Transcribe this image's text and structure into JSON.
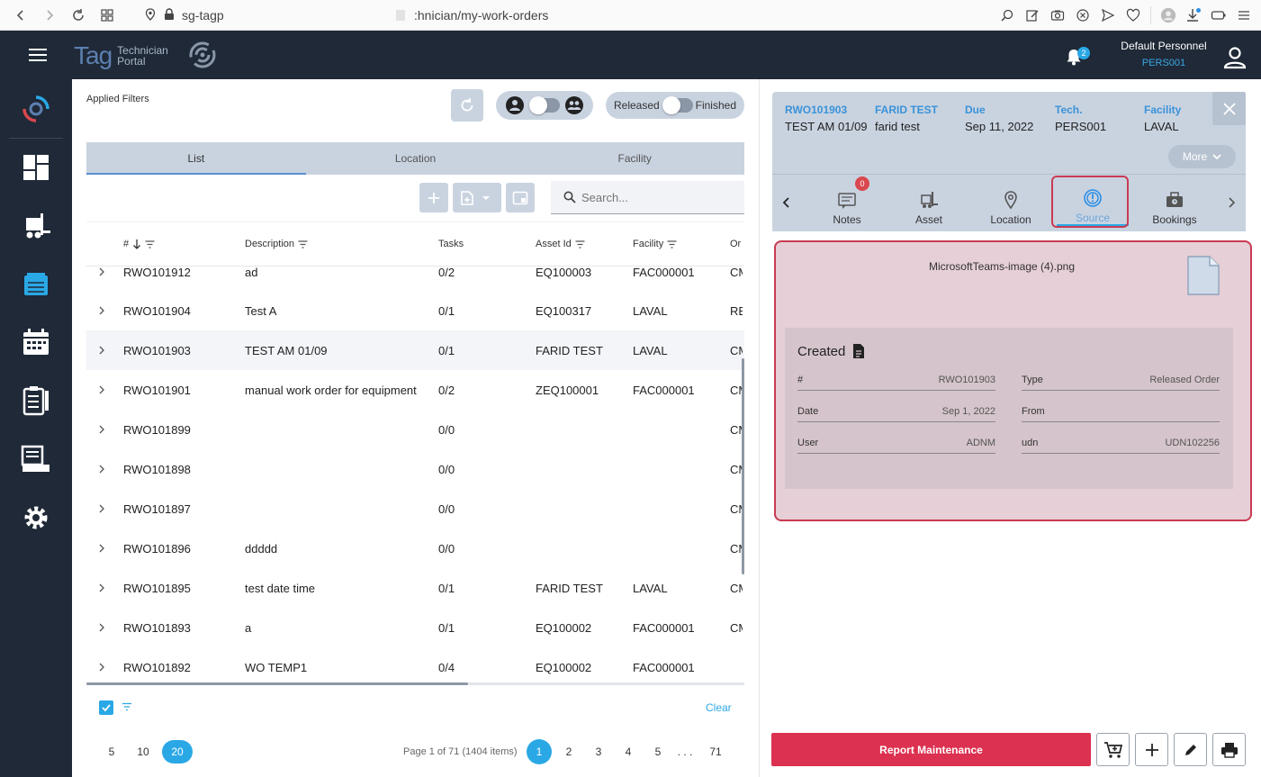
{
  "browser": {
    "url_host": "sg-tagp",
    "url_path": ":hnician/my-work-orders"
  },
  "header": {
    "brand_tag": "Tag",
    "brand_line1": "Technician",
    "brand_line2": "Portal",
    "notification_count": "2",
    "user_name": "Default Personnel",
    "user_code": "PERS001"
  },
  "filters": {
    "applied_label": "Applied Filters",
    "released_label": "Released",
    "finished_label": "Finished"
  },
  "tabs": [
    {
      "label": "List"
    },
    {
      "label": "Location"
    },
    {
      "label": "Facility"
    }
  ],
  "search": {
    "placeholder": "Search..."
  },
  "table": {
    "headers": {
      "number": "#",
      "description": "Description",
      "tasks": "Tasks",
      "asset_id": "Asset Id",
      "facility": "Facility",
      "origin": "Or"
    },
    "rows": [
      {
        "id": "RWO101912",
        "desc": "ad",
        "tasks": "0/2",
        "asset": "EQ100003",
        "facility": "FAC000001",
        "or": "CM"
      },
      {
        "id": "RWO101904",
        "desc": "Test A",
        "tasks": "0/1",
        "asset": "EQ100317",
        "facility": "LAVAL",
        "or": "RE"
      },
      {
        "id": "RWO101903",
        "desc": "TEST AM 01/09",
        "tasks": "0/1",
        "asset": "FARID TEST",
        "facility": "LAVAL",
        "or": "CM"
      },
      {
        "id": "RWO101901",
        "desc": "manual work order for equipment",
        "tasks": "0/2",
        "asset": "ZEQ100001",
        "facility": "FAC000001",
        "or": "CM"
      },
      {
        "id": "RWO101899",
        "desc": "",
        "tasks": "0/0",
        "asset": "",
        "facility": "",
        "or": "CM"
      },
      {
        "id": "RWO101898",
        "desc": "",
        "tasks": "0/0",
        "asset": "",
        "facility": "",
        "or": "CM"
      },
      {
        "id": "RWO101897",
        "desc": "",
        "tasks": "0/0",
        "asset": "",
        "facility": "",
        "or": "CM"
      },
      {
        "id": "RWO101896",
        "desc": "ddddd",
        "tasks": "0/0",
        "asset": "",
        "facility": "",
        "or": "CM"
      },
      {
        "id": "RWO101895",
        "desc": "test date time",
        "tasks": "0/1",
        "asset": "FARID TEST",
        "facility": "LAVAL",
        "or": "CM"
      },
      {
        "id": "RWO101893",
        "desc": "a",
        "tasks": "0/1",
        "asset": "EQ100002",
        "facility": "FAC000001",
        "or": "CM"
      },
      {
        "id": "RWO101892",
        "desc": "WO TEMP1",
        "tasks": "0/4",
        "asset": "EQ100002",
        "facility": "FAC000001",
        "or": ""
      }
    ]
  },
  "footer": {
    "clear_label": "Clear",
    "page_sizes": [
      "5",
      "10",
      "20"
    ],
    "page_info": "Page 1 of 71 (1404 items)",
    "pages": [
      "1",
      "2",
      "3",
      "4",
      "5",
      ". . .",
      "71"
    ]
  },
  "detail": {
    "id_label": "RWO101903",
    "id_value": "TEST AM 01/09",
    "asset_label": "FARID TEST",
    "asset_value": "farid test",
    "due_label": "Due",
    "due_value": "Sep 11, 2022",
    "tech_label": "Tech.",
    "tech_value": "PERS001",
    "facility_label": "Facility",
    "facility_value": "LAVAL",
    "more_label": "More",
    "tabs": [
      {
        "label": "Notes",
        "badge": "0"
      },
      {
        "label": "Asset"
      },
      {
        "label": "Location"
      },
      {
        "label": "Source"
      },
      {
        "label": "Bookings"
      }
    ]
  },
  "source": {
    "file_name": "MicrosoftTeams-image (4).png",
    "created_title": "Created",
    "fields": {
      "num_k": "#",
      "num_v": "RWO101903",
      "type_k": "Type",
      "type_v": "Released Order",
      "date_k": "Date",
      "date_v": "Sep 1, 2022",
      "from_k": "From",
      "from_v": "",
      "user_k": "User",
      "user_v": "ADNM",
      "udn_k": "udn",
      "udn_v": "UDN102256"
    }
  },
  "actions": {
    "report_label": "Report Maintenance"
  },
  "colors": {
    "accent": "#2aa8e6",
    "header_bg": "#1f2937",
    "danger": "#dc3150",
    "highlight_border": "#c93a52"
  }
}
